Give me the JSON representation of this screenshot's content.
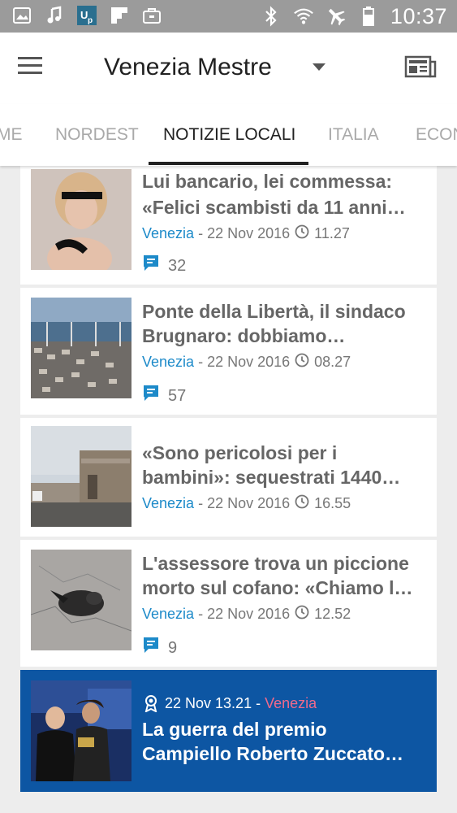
{
  "status_bar": {
    "time": "10:37",
    "left_icons": [
      "image-icon",
      "music-note-icon",
      "app-badge-icon",
      "flipboard-icon",
      "briefcase-icon"
    ],
    "right_icons": [
      "bluetooth-icon",
      "wifi-icon",
      "airplane-mode-icon",
      "battery-icon"
    ]
  },
  "header": {
    "title": "Venezia Mestre"
  },
  "tabs": [
    {
      "label": "ME"
    },
    {
      "label": "NORDEST"
    },
    {
      "label": "NOTIZIE LOCALI"
    },
    {
      "label": "ITALIA"
    },
    {
      "label": "ECON"
    }
  ],
  "active_tab": "NOTIZIE LOCALI",
  "articles": [
    {
      "title_1": "Lui bancario, lei commessa:",
      "title_2": "«Felici scambisti da 11 anni…",
      "city": "Venezia",
      "sep": " - ",
      "date": "22 Nov 2016",
      "time": "11.27",
      "comments": "32"
    },
    {
      "title_1": "Ponte della Libertà, il sindaco",
      "title_2": "Brugnaro: dobbiamo…",
      "city": "Venezia",
      "sep": " - ",
      "date": "22 Nov 2016",
      "time": "08.27",
      "comments": "57"
    },
    {
      "title_1": "«Sono pericolosi per i",
      "title_2": "bambini»: sequestrati 1440…",
      "city": "Venezia",
      "sep": " - ",
      "date": "22 Nov 2016",
      "time": "16.55",
      "comments": ""
    },
    {
      "title_1": "L'assessore trova un piccione",
      "title_2": "morto sul cofano: «Chiamo l…",
      "city": "Venezia",
      "sep": " - ",
      "date": "22 Nov 2016",
      "time": "12.52",
      "comments": "9"
    }
  ],
  "featured": {
    "date_time": "22 Nov 13.21",
    "sep": " - ",
    "city": "Venezia",
    "title_1": "La guerra del premio",
    "title_2": "Campiello Roberto Zuccato…"
  },
  "colors": {
    "accent_blue": "#1d8ac9",
    "featured_bg": "#0d56a3",
    "featured_city": "#f06a8c"
  }
}
